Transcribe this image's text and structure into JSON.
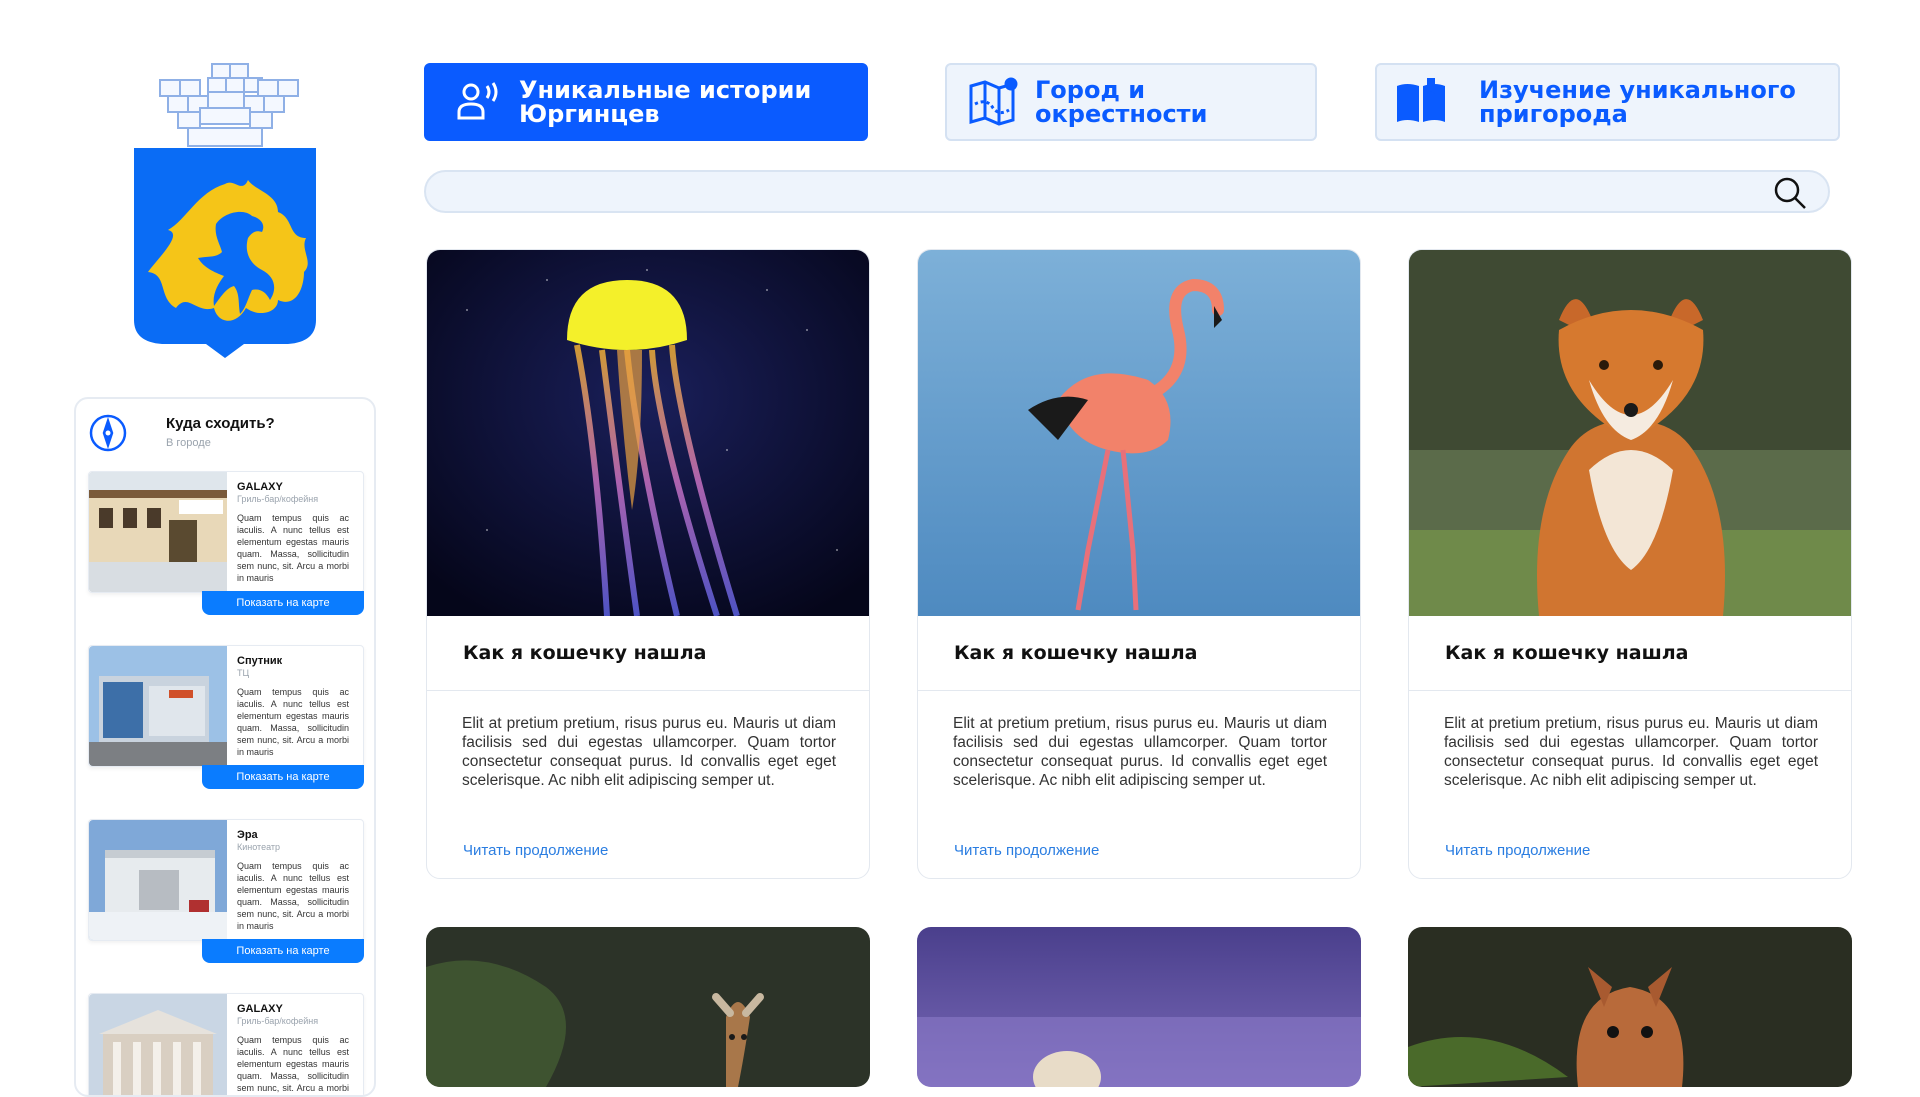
{
  "nav": {
    "btn1": "Уникальные истории Юргинцев",
    "btn2": "Город и окрестности",
    "btn3": "Изучение уникального пригорода"
  },
  "search": {
    "placeholder": "",
    "value": ""
  },
  "sidebar": {
    "title": "Куда сходить?",
    "subtitle": "В городе",
    "places": [
      {
        "name": "GALAXY",
        "category": "Гриль-бар/кофейня",
        "desc": "Quam tempus quis ac iaculis. A nunc tellus est elementum egestas mauris quam. Massa, sollicitudin sem nunc, sit. Arcu a morbi in mauris",
        "button": "Показать на карте"
      },
      {
        "name": "Спутник",
        "category": "ТЦ",
        "desc": "Quam tempus quis ac iaculis. A nunc tellus est elementum egestas mauris quam. Massa, sollicitudin sem nunc, sit. Arcu a morbi in mauris",
        "button": "Показать на карте"
      },
      {
        "name": "Эра",
        "category": "Кинотеатр",
        "desc": "Quam tempus quis ac iaculis. A nunc tellus est elementum egestas mauris quam. Massa, sollicitudin sem nunc, sit. Arcu a morbi in mauris",
        "button": "Показать на карте"
      },
      {
        "name": "GALAXY",
        "category": "Гриль-бар/кофейня",
        "desc": "Quam tempus quis ac iaculis. A nunc tellus est elementum egestas mauris quam. Massa, sollicitudin sem nunc, sit. Arcu a morbi in mauris",
        "button": ""
      }
    ]
  },
  "cards": [
    {
      "title": "Как я кошечку нашла",
      "text": "Elit at pretium pretium, risus purus eu. Mauris ut diam facilisis sed dui egestas ullamcorper. Quam tortor consectetur consequat purus. Id convallis eget eget scelerisque. Ac nibh elit adipiscing semper ut.",
      "more": "Читать продолжение",
      "image": "jellyfish"
    },
    {
      "title": "Как я кошечку нашла",
      "text": "Elit at pretium pretium, risus purus eu. Mauris ut diam facilisis sed dui egestas ullamcorper. Quam tortor consectetur consequat purus. Id convallis eget eget scelerisque. Ac nibh elit adipiscing semper ut.",
      "more": "Читать продолжение",
      "image": "flamingo"
    },
    {
      "title": "Как я кошечку нашла",
      "text": "Elit at pretium pretium, risus purus eu. Mauris ut diam facilisis sed dui egestas ullamcorper. Quam tortor consectetur consequat purus. Id convallis eget eget scelerisque. Ac nibh elit adipiscing semper ut.",
      "more": "Читать продолжение",
      "image": "fox"
    }
  ],
  "colors": {
    "accent": "#0a5bff",
    "link": "#2a7de1",
    "coat_blue": "#0a6cf5",
    "coat_gold": "#f5c518"
  },
  "icons": [
    "coat-of-arms",
    "podcast-person-icon",
    "map-icon",
    "book-icon",
    "search-icon",
    "compass-icon"
  ]
}
